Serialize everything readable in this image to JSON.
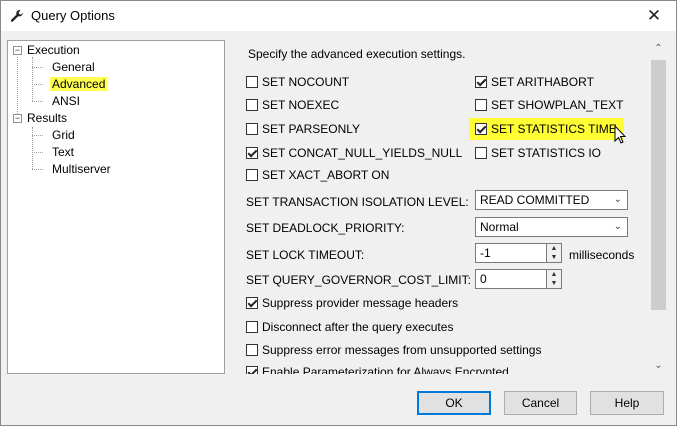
{
  "window": {
    "title": "Query Options",
    "close_glyph": "✕"
  },
  "tree": {
    "execution": "Execution",
    "general": "General",
    "advanced": "Advanced",
    "ansi": "ANSI",
    "results": "Results",
    "grid": "Grid",
    "text": "Text",
    "multiserver": "Multiserver",
    "expander_glyph": "−"
  },
  "panel": {
    "description": "Specify the advanced execution settings.",
    "checks": {
      "nocount": "SET NOCOUNT",
      "noexec": "SET NOEXEC",
      "parseonly": "SET PARSEONLY",
      "concat_null": "SET CONCAT_NULL_YIELDS_NULL",
      "xact_abort": "SET XACT_ABORT ON",
      "arithabort": "SET ARITHABORT",
      "showplan_text": "SET SHOWPLAN_TEXT",
      "statistics_time": "SET STATISTICS TIME",
      "statistics_io": "SET STATISTICS IO"
    },
    "isolation": {
      "label": "SET TRANSACTION ISOLATION LEVEL:",
      "value": "READ COMMITTED"
    },
    "deadlock": {
      "label": "SET DEADLOCK_PRIORITY:",
      "value": "Normal"
    },
    "lock_timeout": {
      "label": "SET LOCK TIMEOUT:",
      "value": "-1",
      "unit": "milliseconds"
    },
    "governor": {
      "label": "SET QUERY_GOVERNOR_COST_LIMIT:",
      "value": "0"
    },
    "options": {
      "suppress_headers": "Suppress provider message headers",
      "disconnect": "Disconnect after the query executes",
      "suppress_errors": "Suppress error messages from unsupported settings",
      "parameterization": "Enable Parameterization for Always Encrypted"
    }
  },
  "buttons": {
    "ok": "OK",
    "cancel": "Cancel",
    "help": "Help"
  },
  "colors": {
    "highlight": "#ffff33",
    "accent": "#0078d7"
  }
}
